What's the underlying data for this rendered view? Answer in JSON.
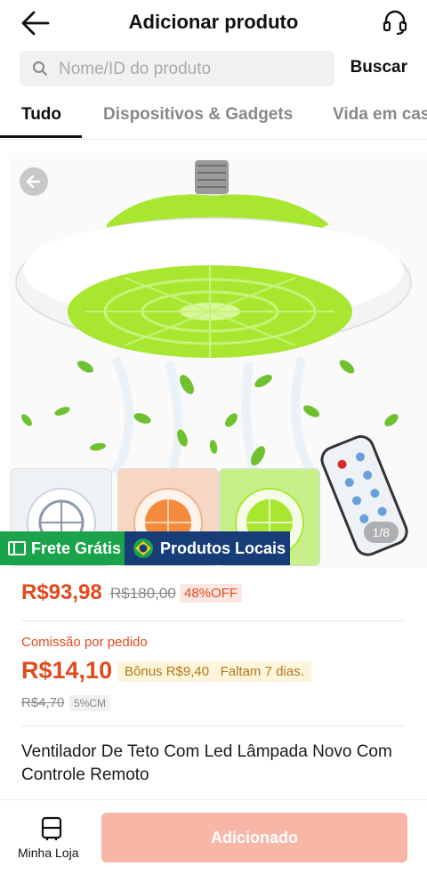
{
  "header": {
    "title": "Adicionar produto",
    "back_icon": "back-arrow-icon",
    "support_icon": "headset-icon"
  },
  "search": {
    "placeholder": "Nome/ID do produto",
    "button_label": "Buscar"
  },
  "tabs": [
    {
      "label": "Tudo",
      "active": true
    },
    {
      "label": "Dispositivos & Gadgets",
      "active": false
    },
    {
      "label": "Vida em cas",
      "active": false
    }
  ],
  "gallery": {
    "counter": "1/8",
    "thumbnails": 3
  },
  "badges": {
    "frete": "Frete Grátis",
    "locais": "Produtos Locais"
  },
  "pricing": {
    "price": "R$93,98",
    "old_price": "R$180,00",
    "discount": "48%OFF"
  },
  "commission": {
    "label": "Comissão por pedido",
    "value": "R$14,10",
    "bonus": "Bônus R$9,40   Faltam 7 dias.",
    "old_value": "R$4,70",
    "percent": "5%CM"
  },
  "product": {
    "title": "Ventilador De Teto Com Led Lâmpada Novo Com Controle Remoto"
  },
  "bottom": {
    "store_label": "Minha Loja",
    "add_button": "Adicionado"
  },
  "colors": {
    "accent": "#e24a1d",
    "frete_green": "#1aa34a",
    "locais_blue": "#163d78",
    "button_disabled": "#f8b6a6",
    "fan_green": "#a8e62f"
  }
}
